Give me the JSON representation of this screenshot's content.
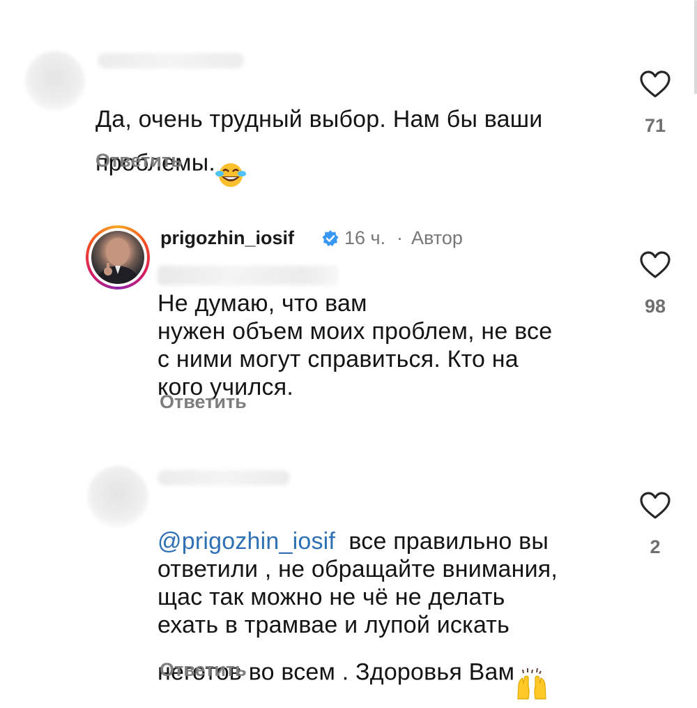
{
  "comments": [
    {
      "text": "Да, очень трудный выбор. Нам бы ваши\nпроблемы.",
      "emoji": "laughing-with-tears",
      "reply_label": "Ответить",
      "likes": "71"
    },
    {
      "author": "prigozhin_iosif",
      "verified": true,
      "time": "16 ч.",
      "separator": "·",
      "role": "Автор",
      "text": "Не думаю, что вам\nнужен объем моих проблем, не все\nс ними могут справиться. Кто на\nкого учился.",
      "reply_label": "Ответить",
      "likes": "98"
    },
    {
      "mention": "@prigozhin_iosif",
      "text": "все правильно вы\nответили , не обращайте внимания,\nщас так можно не чё не делать\nехать в трамвае и  лупой искать\nнеготов во всем .  Здоровья Вам",
      "emoji": "raising-hands",
      "reply_label": "Ответить",
      "likes": "2"
    }
  ],
  "colors": {
    "text": "#141414",
    "secondary": "#7d7d7d",
    "mention": "#2f6fb4",
    "verified": "#3897f0"
  }
}
